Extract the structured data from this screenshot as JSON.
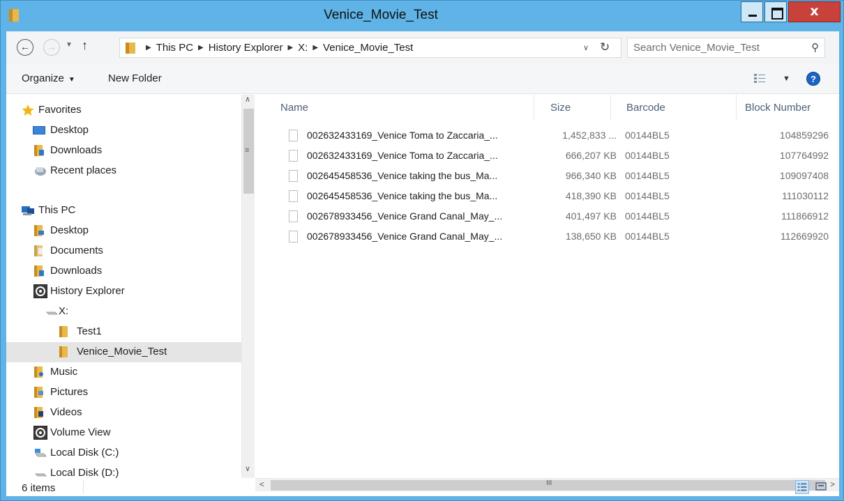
{
  "window": {
    "title": "Venice_Movie_Test",
    "close_glyph": "x"
  },
  "address_bar": {
    "breadcrumbs": [
      "This PC",
      "History Explorer",
      "X:",
      "Venice_Movie_Test"
    ],
    "search_placeholder": "Search Venice_Movie_Test"
  },
  "toolbar": {
    "organize": "Organize",
    "new_folder": "New Folder",
    "help": "?"
  },
  "nav": {
    "items": [
      {
        "label": "Favorites",
        "icon": "star-icon"
      },
      {
        "label": "Desktop",
        "icon": "desktop-icon"
      },
      {
        "label": "Downloads",
        "icon": "downloads-folder-icon"
      },
      {
        "label": "Recent places",
        "icon": "recent-places-icon"
      },
      {
        "label": "This PC",
        "icon": "computer-icon"
      },
      {
        "label": "Desktop",
        "icon": "desktop-folder-icon"
      },
      {
        "label": "Documents",
        "icon": "documents-folder-icon"
      },
      {
        "label": "Downloads",
        "icon": "downloads-folder-icon"
      },
      {
        "label": "History Explorer",
        "icon": "history-explorer-icon"
      },
      {
        "label": "X:",
        "icon": "drive-icon"
      },
      {
        "label": "Test1",
        "icon": "folder-icon"
      },
      {
        "label": "Venice_Movie_Test",
        "icon": "folder-icon",
        "selected": true
      },
      {
        "label": "Music",
        "icon": "music-folder-icon"
      },
      {
        "label": "Pictures",
        "icon": "pictures-folder-icon"
      },
      {
        "label": "Videos",
        "icon": "videos-folder-icon"
      },
      {
        "label": "Volume View",
        "icon": "volume-view-icon"
      },
      {
        "label": "Local Disk (C:)",
        "icon": "system-drive-icon"
      },
      {
        "label": "Local Disk (D:)",
        "icon": "drive-icon"
      }
    ]
  },
  "file_list": {
    "columns": [
      "Name",
      "Size",
      "Barcode",
      "Block Number"
    ],
    "rows": [
      {
        "name": "002632433169_Venice Toma to Zaccaria_...",
        "size": "1,452,833 ...",
        "barcode": "00144BL5",
        "block": "104859296"
      },
      {
        "name": "002632433169_Venice Toma to Zaccaria_...",
        "size": "666,207 KB",
        "barcode": "00144BL5",
        "block": "107764992"
      },
      {
        "name": "002645458536_Venice taking the bus_Ma...",
        "size": "966,340 KB",
        "barcode": "00144BL5",
        "block": "109097408"
      },
      {
        "name": "002645458536_Venice taking the bus_Ma...",
        "size": "418,390 KB",
        "barcode": "00144BL5",
        "block": "111030112"
      },
      {
        "name": "002678933456_Venice Grand Canal_May_...",
        "size": "401,497 KB",
        "barcode": "00144BL5",
        "block": "111866912"
      },
      {
        "name": "002678933456_Venice Grand Canal_May_...",
        "size": "138,650 KB",
        "barcode": "00144BL5",
        "block": "112669920"
      }
    ]
  },
  "status_bar": {
    "item_count": "6 items"
  },
  "colors": {
    "titlebar": "#5fb3e6",
    "close_button": "#c9413b",
    "selected_nav": "#e5e5e5",
    "column_header_text": "#4c607a"
  }
}
